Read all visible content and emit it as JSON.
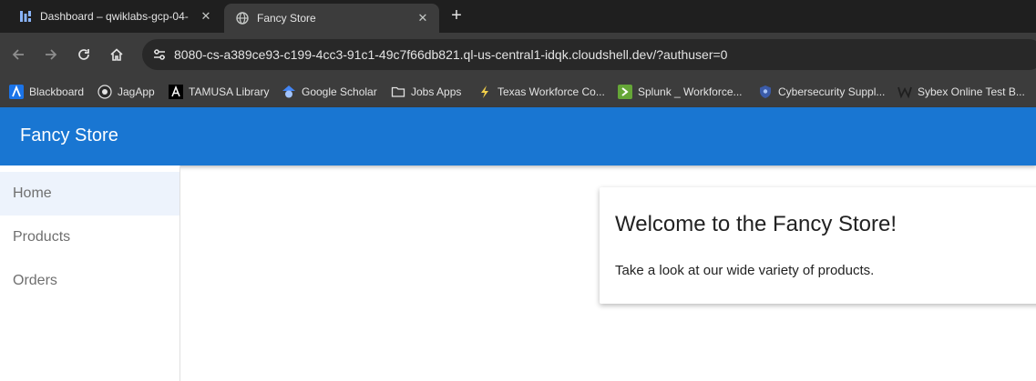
{
  "browser": {
    "tabs": [
      {
        "title": "Dashboard – qwiklabs-gcp-04-",
        "active": false,
        "icon": "dashboard-favicon-icon"
      },
      {
        "title": "Fancy Store",
        "active": true,
        "icon": "globe-favicon-icon"
      }
    ],
    "new_tab_label": "+",
    "close_label": "✕",
    "url": "8080-cs-a389ce93-c199-4cc3-91c1-49c7f66db821.ql-us-central1-idqk.cloudshell.dev/?authuser=0",
    "bookmarks": [
      {
        "label": "Blackboard",
        "icon": "blackboard-icon"
      },
      {
        "label": "JagApp",
        "icon": "jagapp-icon"
      },
      {
        "label": "TAMUSA Library",
        "icon": "library-icon"
      },
      {
        "label": "Google Scholar",
        "icon": "scholar-icon"
      },
      {
        "label": "Jobs Apps",
        "icon": "folder-icon"
      },
      {
        "label": "Texas Workforce Co...",
        "icon": "lightning-icon"
      },
      {
        "label": "Splunk _ Workforce...",
        "icon": "splunk-icon"
      },
      {
        "label": "Cybersecurity Suppl...",
        "icon": "shield-icon"
      },
      {
        "label": "Sybex Online Test B...",
        "icon": "w-icon"
      }
    ]
  },
  "app": {
    "title": "Fancy Store",
    "nav": [
      {
        "label": "Home",
        "active": true
      },
      {
        "label": "Products",
        "active": false
      },
      {
        "label": "Orders",
        "active": false
      }
    ],
    "card": {
      "title": "Welcome to the Fancy Store!",
      "text": "Take a look at our wide variety of products."
    }
  },
  "colors": {
    "appbar": "#1976d2",
    "nav_active": "#edf3fc",
    "browser_dark": "#1f1f1f",
    "browser_toolbar": "#3c3c3c"
  }
}
